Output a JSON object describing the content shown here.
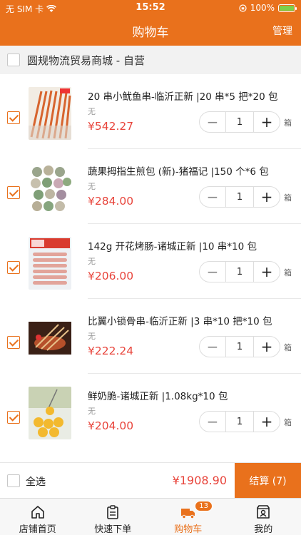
{
  "status": {
    "carrier": "无 SIM 卡",
    "time": "15:52",
    "battery": "100%",
    "battery_level": 1.0
  },
  "nav": {
    "title": "购物车",
    "manage": "管理"
  },
  "shop": {
    "name": "圆规物流贸易商城 - 自营",
    "checked": false
  },
  "items": [
    {
      "name": "20 串小鱿鱼串-临沂正新 |20 串*5 把*20 包",
      "spec": "无",
      "price": "¥542.27",
      "qty": "1",
      "unit": "箱",
      "checked": true,
      "image": "squid-skewers"
    },
    {
      "name": "蔬果拇指生煎包 (新)-猪福记 |150 个*6 包",
      "spec": "无",
      "price": "¥284.00",
      "qty": "1",
      "unit": "箱",
      "checked": true,
      "image": "buns"
    },
    {
      "name": "142g 开花烤肠-诸城正新 |10 串*10 包",
      "spec": "无",
      "price": "¥206.00",
      "qty": "1",
      "unit": "箱",
      "checked": true,
      "image": "sausage"
    },
    {
      "name": "比翼小锁骨串-临沂正新 |3 串*10 把*10 包",
      "spec": "无",
      "price": "¥222.24",
      "qty": "1",
      "unit": "箱",
      "checked": true,
      "image": "bone-skewers"
    },
    {
      "name": "鲜奶脆-诸城正新 |1.08kg*10 包",
      "spec": "无",
      "price": "¥204.00",
      "qty": "1",
      "unit": "箱",
      "checked": true,
      "image": "milk-balls"
    }
  ],
  "controls": {
    "minus": "−",
    "plus": "+"
  },
  "bottom": {
    "select_all": "全选",
    "total": "¥1908.90",
    "checkout": "结算 (7)"
  },
  "tabs": [
    {
      "label": "店铺首页",
      "icon": "home-icon"
    },
    {
      "label": "快速下单",
      "icon": "clipboard-icon"
    },
    {
      "label": "购物车",
      "icon": "truck-icon",
      "badge": "13",
      "active": true
    },
    {
      "label": "我的",
      "icon": "profile-icon"
    }
  ],
  "colors": {
    "accent": "#e9711c",
    "price": "#e8453c"
  }
}
